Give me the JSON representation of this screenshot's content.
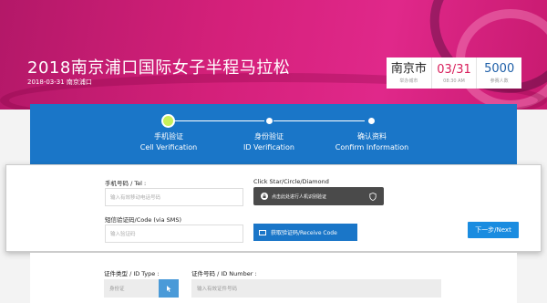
{
  "hero": {
    "title": "2018南京浦口国际女子半程马拉松",
    "date_location": "2018-03-31  南京浦口"
  },
  "stats": {
    "city": {
      "value": "南京市",
      "label": "举办城市"
    },
    "date": {
      "value": "03/31",
      "label": "08:30 AM"
    },
    "participants": {
      "value": "5000",
      "label": "参赛人数"
    }
  },
  "steps": [
    {
      "label_cn": "手机验证",
      "label_en": "Cell Verification",
      "active": true
    },
    {
      "label_cn": "身份验证",
      "label_en": "ID Verification",
      "active": false
    },
    {
      "label_cn": "确认资料",
      "label_en": "Confirm Information",
      "active": false
    }
  ],
  "form": {
    "phone_label": "手机号码 / Tel :",
    "phone_placeholder": "输入有效移动电话号码",
    "captcha_label": "Click Star/Circle/Diamond",
    "captcha_text": "点击此处进行人机识别验证",
    "sms_label": "短信验证码/Code (via SMS)",
    "sms_placeholder": "输入验证码",
    "get_code_button": "获取验证码/Receive Code",
    "next_button": "下一步/Next"
  },
  "lower": {
    "doc_type_label": "证件类型 / ID Type :",
    "doc_type_value": "身份证",
    "id_number_label": "证件号码 / ID Number :",
    "id_number_placeholder": "输入有效证件号码"
  },
  "colors": {
    "brand_magenta": "#d4207a",
    "step_blue": "#1a76c8",
    "active_dot": "#c9ef5a",
    "date_red": "#d81e5b",
    "count_blue": "#1e5fa8"
  }
}
